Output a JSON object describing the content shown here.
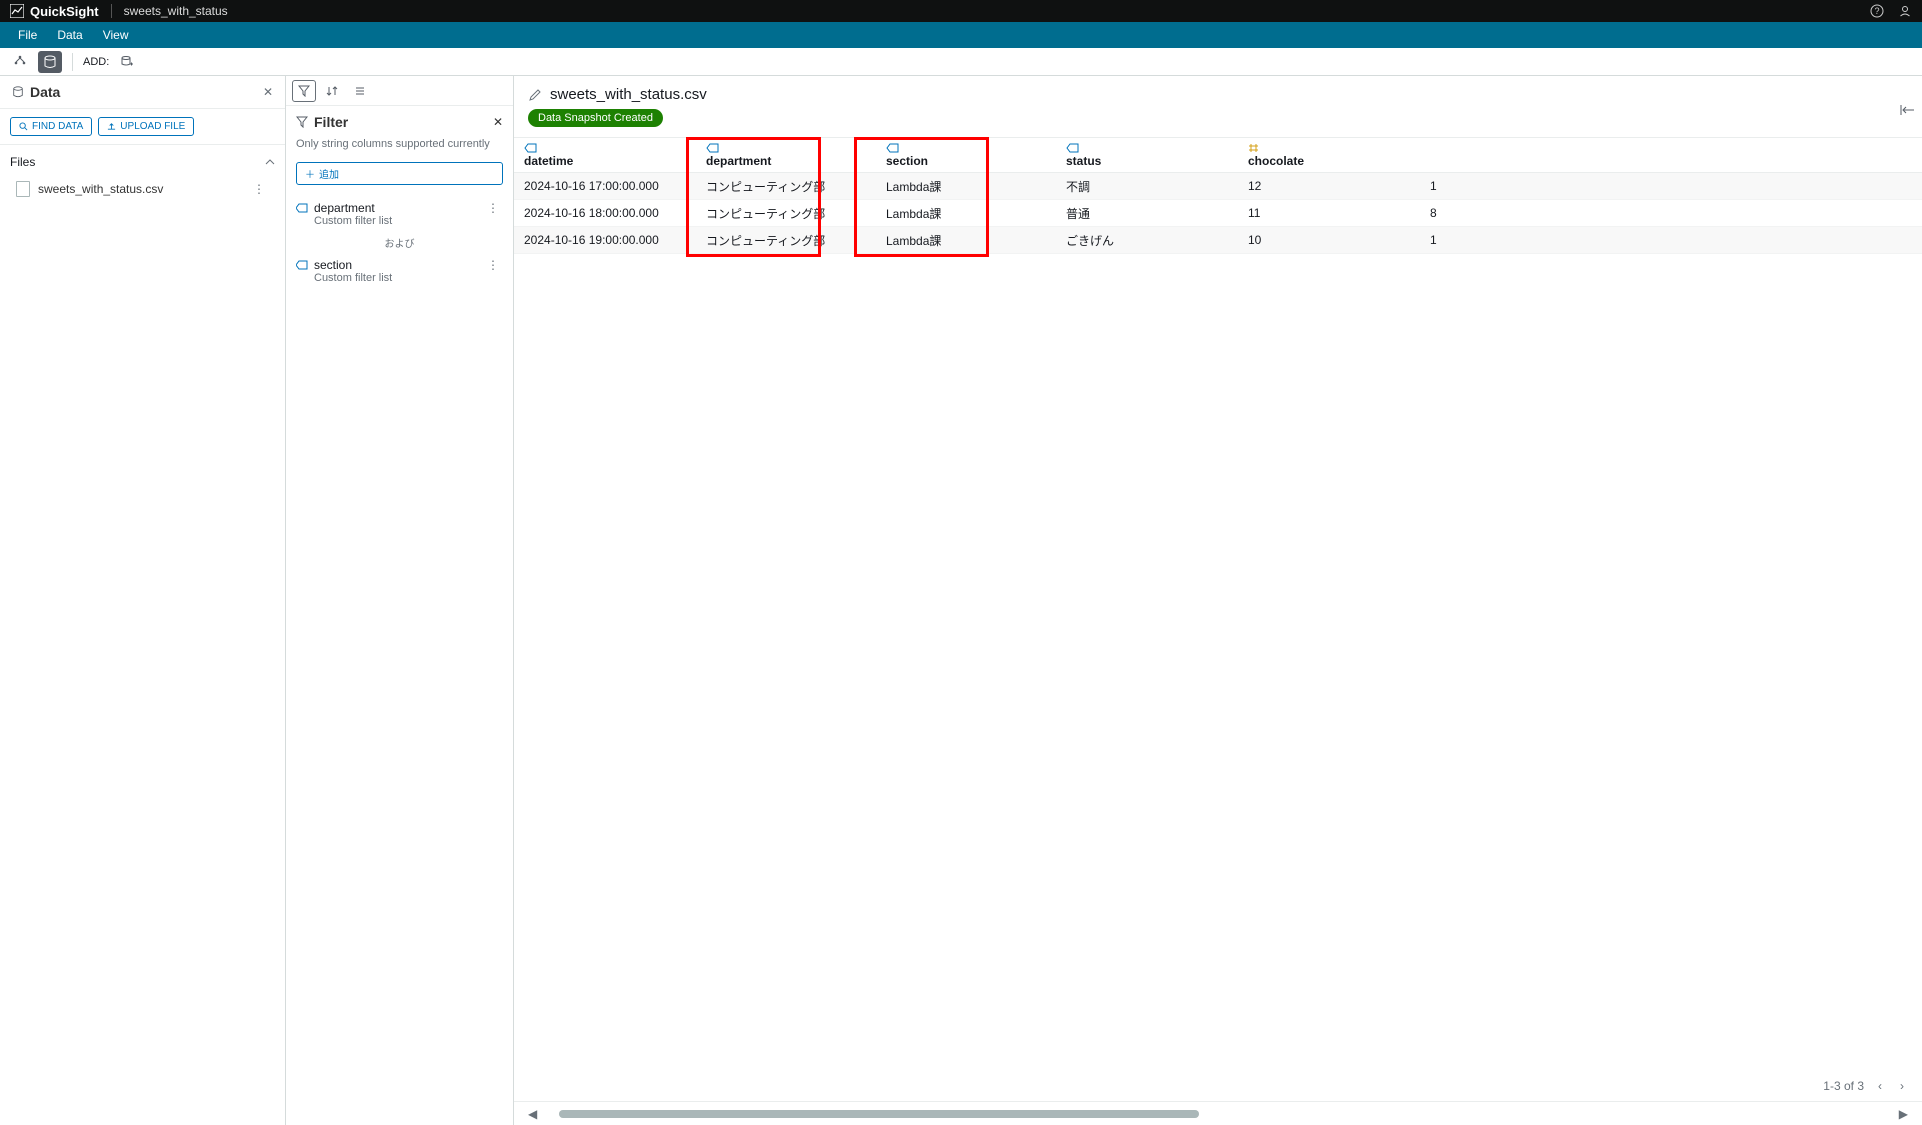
{
  "app": {
    "name": "QuickSight",
    "doc": "sweets_with_status"
  },
  "menu": {
    "file": "File",
    "data": "Data",
    "view": "View"
  },
  "toolbar": {
    "add": "ADD:"
  },
  "data_panel": {
    "title": "Data",
    "find_data": "FIND DATA",
    "upload_file": "UPLOAD FILE",
    "files_label": "Files",
    "file_name": "sweets_with_status.csv"
  },
  "filter_panel": {
    "title": "Filter",
    "note": "Only string columns supported currently",
    "add": "追加",
    "items": [
      {
        "name": "department",
        "sub": "Custom filter list"
      },
      {
        "name": "section",
        "sub": "Custom filter list"
      }
    ],
    "conj": "および"
  },
  "content": {
    "title": "sweets_with_status.csv",
    "badge": "Data Snapshot Created"
  },
  "table": {
    "columns": [
      {
        "key": "datetime",
        "label": "datetime",
        "type": "string"
      },
      {
        "key": "department",
        "label": "department",
        "type": "string"
      },
      {
        "key": "section",
        "label": "section",
        "type": "string"
      },
      {
        "key": "status",
        "label": "status",
        "type": "string"
      },
      {
        "key": "chocolate",
        "label": "chocolate",
        "type": "number"
      }
    ],
    "rows": [
      {
        "datetime": "2024-10-16 17:00:00.000",
        "department": "コンピューティング部",
        "section": "Lambda課",
        "status": "不調",
        "chocolate": "12",
        "extra": "1"
      },
      {
        "datetime": "2024-10-16 18:00:00.000",
        "department": "コンピューティング部",
        "section": "Lambda課",
        "status": "普通",
        "chocolate": "11",
        "extra": "8"
      },
      {
        "datetime": "2024-10-16 19:00:00.000",
        "department": "コンピューティング部",
        "section": "Lambda課",
        "status": "ごきげん",
        "chocolate": "10",
        "extra": "1"
      }
    ]
  },
  "pager": {
    "text": "1-3 of 3"
  }
}
